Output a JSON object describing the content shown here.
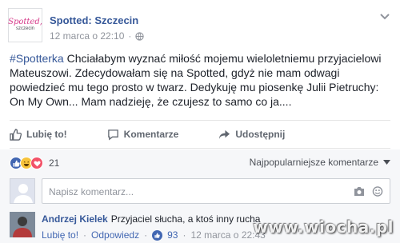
{
  "page": {
    "logo_text": "Spotted,",
    "logo_subtext": "szczecin",
    "name": "Spotted: Szczecin",
    "date": "12 marca o 22:10",
    "separator": "·"
  },
  "post": {
    "hashtag": "#Spotterka",
    "text": " Chciałabym wyznać miłość mojemu wieloletniemu przyjacielowi Mateuszowi. Zdecydowałam się na Spotted, gdyż nie mam odwagi powiedzieć mu tego prosto w twarz. Dedykuję mu piosenkę Julii Pietruchy: On My Own... Mam nadzieję, że czujesz to samo co ja...."
  },
  "actions": {
    "like": "Lubię to!",
    "comment": "Komentarze",
    "share": "Udostępnij"
  },
  "reactions": {
    "count": "21",
    "icons": [
      "like-icon",
      "haha-icon",
      "love-icon"
    ],
    "sort_label": "Najpopularniejsze komentarze"
  },
  "comment_input": {
    "placeholder": "Napisz komentarz..."
  },
  "comment": {
    "author": "Andrzej Kielek",
    "text": "Przyjaciel słucha, a ktoś inny rucha",
    "like_label": "Lubię to!",
    "reply_label": "Odpowiedz",
    "likes": "93",
    "time": "12 marca o 22:43",
    "separator": "·"
  },
  "watermark": "www.wiocha.pl",
  "colors": {
    "link": "#365899",
    "accent": "#4267b2",
    "logo": "#d63a8a",
    "muted": "#90949c"
  }
}
